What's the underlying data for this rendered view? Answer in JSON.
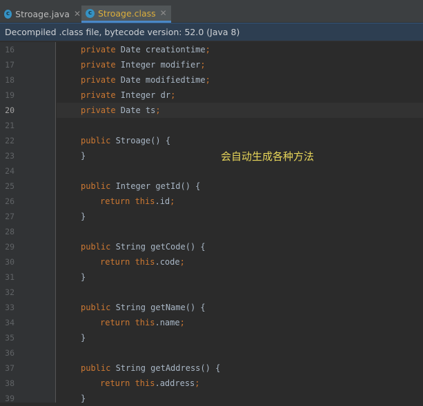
{
  "tabs": [
    {
      "label": "Stroage.java",
      "icon": "class-icon",
      "active": false
    },
    {
      "label": "Stroage.class",
      "icon": "class-icon",
      "active": true
    }
  ],
  "infobar": {
    "text": "Decompiled .class file, bytecode version: 52.0 (Java 8)"
  },
  "annotation": "会自动生成各种方法",
  "current_line": 20,
  "lines": [
    {
      "n": "16",
      "tokens": [
        {
          "t": "private",
          "k": "kw"
        },
        {
          "t": " Date creationtime",
          "k": "pl"
        },
        {
          "t": ";",
          "k": "kw"
        }
      ]
    },
    {
      "n": "17",
      "tokens": [
        {
          "t": "private",
          "k": "kw"
        },
        {
          "t": " Integer modifier",
          "k": "pl"
        },
        {
          "t": ";",
          "k": "kw"
        }
      ]
    },
    {
      "n": "18",
      "tokens": [
        {
          "t": "private",
          "k": "kw"
        },
        {
          "t": " Date modifiedtime",
          "k": "pl"
        },
        {
          "t": ";",
          "k": "kw"
        }
      ]
    },
    {
      "n": "19",
      "tokens": [
        {
          "t": "private",
          "k": "kw"
        },
        {
          "t": " Integer dr",
          "k": "pl"
        },
        {
          "t": ";",
          "k": "kw"
        }
      ]
    },
    {
      "n": "20",
      "tokens": [
        {
          "t": "private",
          "k": "kw"
        },
        {
          "t": " Date ts",
          "k": "pl"
        },
        {
          "t": ";",
          "k": "kw"
        }
      ]
    },
    {
      "n": "21",
      "tokens": []
    },
    {
      "n": "22",
      "tokens": [
        {
          "t": "public",
          "k": "kw"
        },
        {
          "t": " Stroage() {",
          "k": "pl"
        }
      ]
    },
    {
      "n": "23",
      "tokens": [
        {
          "t": "}",
          "k": "pl"
        }
      ]
    },
    {
      "n": "24",
      "tokens": []
    },
    {
      "n": "25",
      "tokens": [
        {
          "t": "public",
          "k": "kw"
        },
        {
          "t": " Integer getId() {",
          "k": "pl"
        }
      ]
    },
    {
      "n": "26",
      "indent": 2,
      "tokens": [
        {
          "t": "return this",
          "k": "kw"
        },
        {
          "t": ".id",
          "k": "pl"
        },
        {
          "t": ";",
          "k": "kw"
        }
      ]
    },
    {
      "n": "27",
      "tokens": [
        {
          "t": "}",
          "k": "pl"
        }
      ]
    },
    {
      "n": "28",
      "tokens": []
    },
    {
      "n": "29",
      "tokens": [
        {
          "t": "public",
          "k": "kw"
        },
        {
          "t": " String getCode() {",
          "k": "pl"
        }
      ]
    },
    {
      "n": "30",
      "indent": 2,
      "tokens": [
        {
          "t": "return this",
          "k": "kw"
        },
        {
          "t": ".code",
          "k": "pl"
        },
        {
          "t": ";",
          "k": "kw"
        }
      ]
    },
    {
      "n": "31",
      "tokens": [
        {
          "t": "}",
          "k": "pl"
        }
      ]
    },
    {
      "n": "32",
      "tokens": []
    },
    {
      "n": "33",
      "tokens": [
        {
          "t": "public",
          "k": "kw"
        },
        {
          "t": " String getName() {",
          "k": "pl"
        }
      ]
    },
    {
      "n": "34",
      "indent": 2,
      "tokens": [
        {
          "t": "return this",
          "k": "kw"
        },
        {
          "t": ".name",
          "k": "pl"
        },
        {
          "t": ";",
          "k": "kw"
        }
      ]
    },
    {
      "n": "35",
      "tokens": [
        {
          "t": "}",
          "k": "pl"
        }
      ]
    },
    {
      "n": "36",
      "tokens": []
    },
    {
      "n": "37",
      "tokens": [
        {
          "t": "public",
          "k": "kw"
        },
        {
          "t": " String getAddress() {",
          "k": "pl"
        }
      ]
    },
    {
      "n": "38",
      "indent": 2,
      "tokens": [
        {
          "t": "return this",
          "k": "kw"
        },
        {
          "t": ".address",
          "k": "pl"
        },
        {
          "t": ";",
          "k": "kw"
        }
      ]
    },
    {
      "n": "39",
      "tokens": [
        {
          "t": "}",
          "k": "pl"
        }
      ]
    }
  ],
  "colors": {
    "keyword": "#cc7832",
    "plain": "#a9b7c6",
    "annotation": "#e8d65a",
    "active_tab": "#dcae3c"
  }
}
